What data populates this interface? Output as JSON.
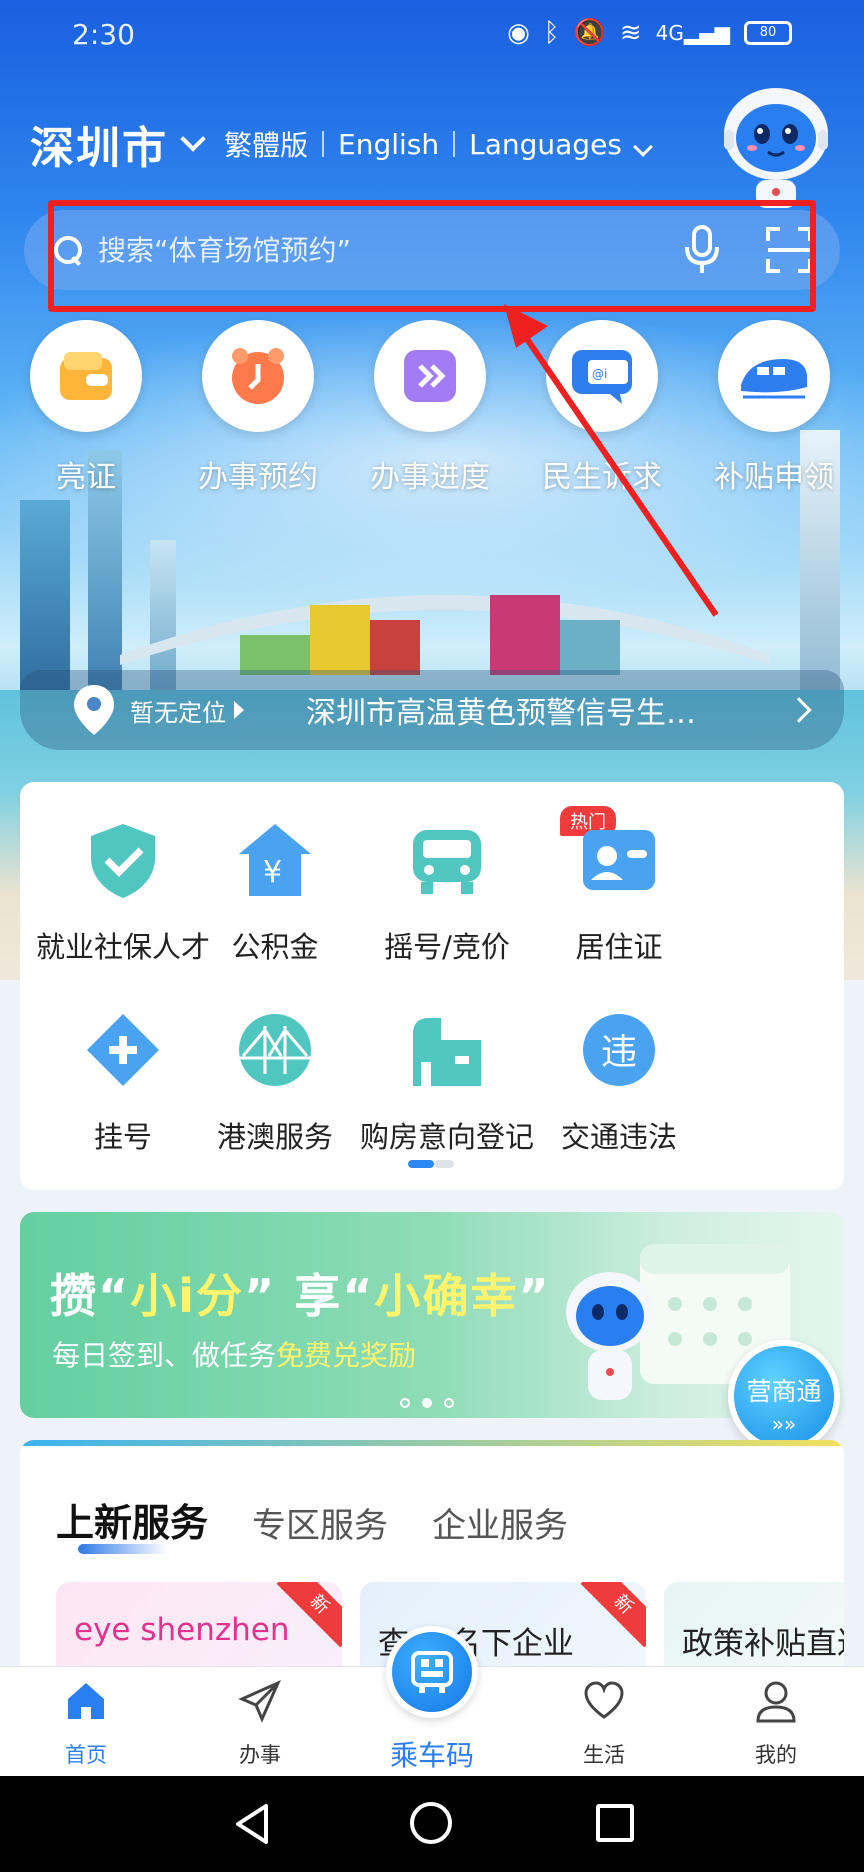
{
  "status_bar": {
    "time": "2:30",
    "network": "4G",
    "battery": "80"
  },
  "header": {
    "city": "深圳市",
    "traditional": "繁體版",
    "english": "English",
    "languages": "Languages"
  },
  "search": {
    "placeholder": "搜索“体育场馆预约”"
  },
  "quick_actions": [
    {
      "label": "亮证",
      "icon": "wallet-icon"
    },
    {
      "label": "办事预约",
      "icon": "clock-icon"
    },
    {
      "label": "办事进度",
      "icon": "progress-icon"
    },
    {
      "label": "民生诉求",
      "icon": "chat-icon"
    },
    {
      "label": "补贴申领",
      "icon": "train-icon"
    }
  ],
  "location_bar": {
    "location": "暂无定位",
    "alert": "深圳市高温黄色预警信号生…"
  },
  "services": [
    {
      "label": "就业社保人才",
      "icon": "shield-check-icon"
    },
    {
      "label": "公积金",
      "icon": "yuan-house-icon"
    },
    {
      "label": "摇号/竞价",
      "icon": "car-icon",
      "badge": "热门"
    },
    {
      "label": "居住证",
      "icon": "id-card-icon"
    },
    {
      "label": "挂号",
      "icon": "medical-plus-icon"
    },
    {
      "label": "港澳服务",
      "icon": "bridge-icon"
    },
    {
      "label": "购房意向登记",
      "icon": "building-icon"
    },
    {
      "label": "交通违法",
      "icon": "violation-icon"
    }
  ],
  "promo": {
    "title_a": "攒“",
    "title_b": "小i分",
    "title_c": "” 享“",
    "title_d": "小确幸",
    "title_e": "”",
    "sub_a": "每日签到、做任务",
    "sub_b": "免费兑奖励",
    "float_button": "营商通"
  },
  "section": {
    "tabs": [
      "上新服务",
      "专区服务",
      "企业服务"
    ],
    "tiles": [
      {
        "text": "eye shenzhen",
        "badge": "新"
      },
      {
        "text": "查 人名下企业",
        "badge": "新"
      },
      {
        "text": "政策补贴直达"
      }
    ]
  },
  "bottom_nav": {
    "items": [
      "首页",
      "办事",
      "乘车码",
      "生活",
      "我的"
    ]
  },
  "colors": {
    "accent": "#2a7ff0",
    "highlight": "#ee2020",
    "hot": "#ef3b3b"
  }
}
